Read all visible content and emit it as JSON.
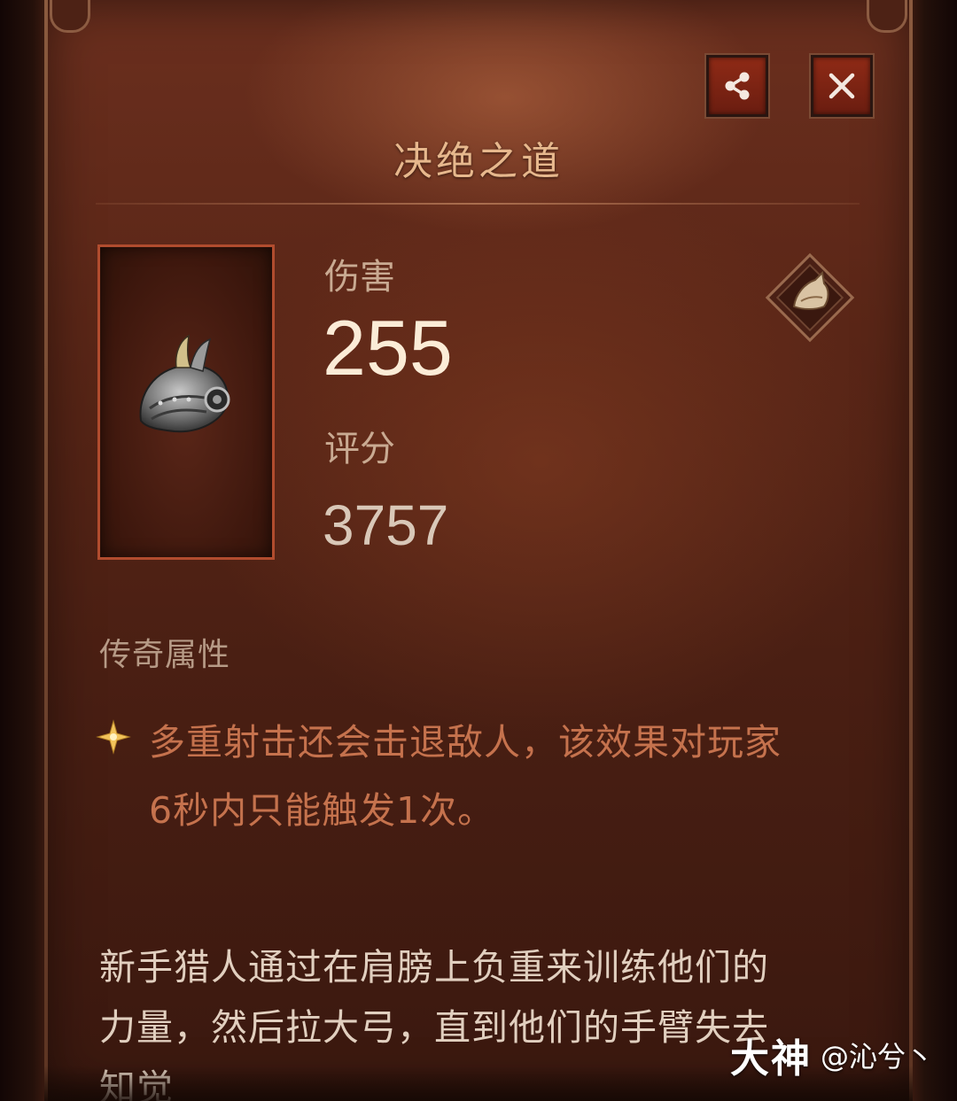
{
  "item": {
    "name": "决绝之道",
    "stats": {
      "damage_label": "伤害",
      "damage_value": "255",
      "score_label": "评分",
      "score_value": "3757"
    },
    "legendary": {
      "section_title": "传奇属性",
      "effect_line1": "多重射击还会击退敌人，该效果对玩家",
      "effect_line2": "6秒内只能触发1次。"
    },
    "flavor": {
      "line1": "新手猎人通过在肩膀上负重来训练他们的",
      "line2": "力量，然后拉大弓，直到他们的手臂失去",
      "line3": "知觉"
    }
  },
  "toolbar": {
    "share_icon": "share-icon",
    "close_icon": "close-icon"
  },
  "watermark": {
    "logo": "大神",
    "user": "@沁兮丶"
  },
  "colors": {
    "title": "#e7b88d",
    "legendary_text": "#c5724d",
    "slot_border": "#b14c2e",
    "button_fill": "#8f2a16"
  }
}
